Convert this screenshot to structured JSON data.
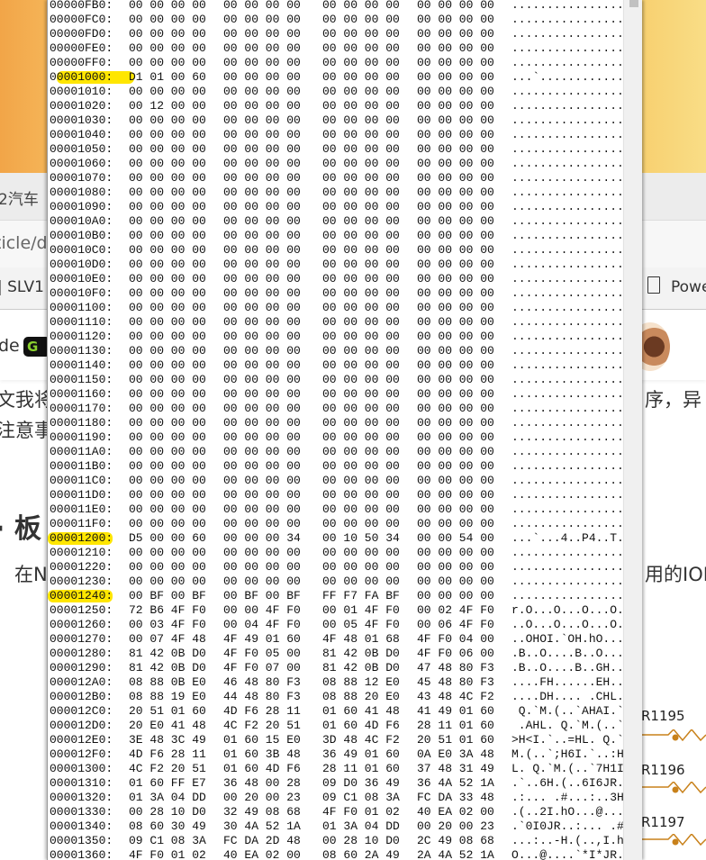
{
  "background": {
    "tab_text": "2汽车",
    "address_text": "ticle/d",
    "bookmark_left": "| SLV1",
    "bookmark_right": "Powe",
    "author_left": "de",
    "badge": "G",
    "para_line1_left": "文我将",
    "para_line2_left": "注意事",
    "para_line1_right": "序，异",
    "heading_left": "· 板",
    "para2_left": "在N",
    "para2_right": "用的IOD",
    "resistors": [
      "R1195",
      "R1196",
      "R1197"
    ],
    "accent": "#c8811a"
  },
  "hex_view": {
    "rows": [
      {
        "offset": "00000FB0:",
        "hex": [
          "00 00 00 00",
          "00 00 00 00",
          "00 00 00 00",
          "00 00 00 00"
        ],
        "ascii": "................"
      },
      {
        "offset": "00000FC0:",
        "hex": [
          "00 00 00 00",
          "00 00 00 00",
          "00 00 00 00",
          "00 00 00 00"
        ],
        "ascii": "................"
      },
      {
        "offset": "00000FD0:",
        "hex": [
          "00 00 00 00",
          "00 00 00 00",
          "00 00 00 00",
          "00 00 00 00"
        ],
        "ascii": "................"
      },
      {
        "offset": "00000FE0:",
        "hex": [
          "00 00 00 00",
          "00 00 00 00",
          "00 00 00 00",
          "00 00 00 00"
        ],
        "ascii": "................"
      },
      {
        "offset": "00000FF0:",
        "hex": [
          "00 00 00 00",
          "00 00 00 00",
          "00 00 00 00",
          "00 00 00 00"
        ],
        "ascii": "................"
      },
      {
        "offset": "00001000:",
        "hex": [
          "D1 01 00 60",
          "00 00 00 00",
          "00 00 00 00",
          "00 00 00 00"
        ],
        "ascii": "...`............",
        "highlight": true
      },
      {
        "offset": "00001010:",
        "hex": [
          "00 00 00 00",
          "00 00 00 00",
          "00 00 00 00",
          "00 00 00 00"
        ],
        "ascii": "................"
      },
      {
        "offset": "00001020:",
        "hex": [
          "00 12 00 00",
          "00 00 00 00",
          "00 00 00 00",
          "00 00 00 00"
        ],
        "ascii": "................"
      },
      {
        "offset": "00001030:",
        "hex": [
          "00 00 00 00",
          "00 00 00 00",
          "00 00 00 00",
          "00 00 00 00"
        ],
        "ascii": "................"
      },
      {
        "offset": "00001040:",
        "hex": [
          "00 00 00 00",
          "00 00 00 00",
          "00 00 00 00",
          "00 00 00 00"
        ],
        "ascii": "................"
      },
      {
        "offset": "00001050:",
        "hex": [
          "00 00 00 00",
          "00 00 00 00",
          "00 00 00 00",
          "00 00 00 00"
        ],
        "ascii": "................"
      },
      {
        "offset": "00001060:",
        "hex": [
          "00 00 00 00",
          "00 00 00 00",
          "00 00 00 00",
          "00 00 00 00"
        ],
        "ascii": "................"
      },
      {
        "offset": "00001070:",
        "hex": [
          "00 00 00 00",
          "00 00 00 00",
          "00 00 00 00",
          "00 00 00 00"
        ],
        "ascii": "................"
      },
      {
        "offset": "00001080:",
        "hex": [
          "00 00 00 00",
          "00 00 00 00",
          "00 00 00 00",
          "00 00 00 00"
        ],
        "ascii": "................"
      },
      {
        "offset": "00001090:",
        "hex": [
          "00 00 00 00",
          "00 00 00 00",
          "00 00 00 00",
          "00 00 00 00"
        ],
        "ascii": "................"
      },
      {
        "offset": "000010A0:",
        "hex": [
          "00 00 00 00",
          "00 00 00 00",
          "00 00 00 00",
          "00 00 00 00"
        ],
        "ascii": "................"
      },
      {
        "offset": "000010B0:",
        "hex": [
          "00 00 00 00",
          "00 00 00 00",
          "00 00 00 00",
          "00 00 00 00"
        ],
        "ascii": "................"
      },
      {
        "offset": "000010C0:",
        "hex": [
          "00 00 00 00",
          "00 00 00 00",
          "00 00 00 00",
          "00 00 00 00"
        ],
        "ascii": "................"
      },
      {
        "offset": "000010D0:",
        "hex": [
          "00 00 00 00",
          "00 00 00 00",
          "00 00 00 00",
          "00 00 00 00"
        ],
        "ascii": "................"
      },
      {
        "offset": "000010E0:",
        "hex": [
          "00 00 00 00",
          "00 00 00 00",
          "00 00 00 00",
          "00 00 00 00"
        ],
        "ascii": "................"
      },
      {
        "offset": "000010F0:",
        "hex": [
          "00 00 00 00",
          "00 00 00 00",
          "00 00 00 00",
          "00 00 00 00"
        ],
        "ascii": "................"
      },
      {
        "offset": "00001100:",
        "hex": [
          "00 00 00 00",
          "00 00 00 00",
          "00 00 00 00",
          "00 00 00 00"
        ],
        "ascii": "................"
      },
      {
        "offset": "00001110:",
        "hex": [
          "00 00 00 00",
          "00 00 00 00",
          "00 00 00 00",
          "00 00 00 00"
        ],
        "ascii": "................"
      },
      {
        "offset": "00001120:",
        "hex": [
          "00 00 00 00",
          "00 00 00 00",
          "00 00 00 00",
          "00 00 00 00"
        ],
        "ascii": "................"
      },
      {
        "offset": "00001130:",
        "hex": [
          "00 00 00 00",
          "00 00 00 00",
          "00 00 00 00",
          "00 00 00 00"
        ],
        "ascii": "................"
      },
      {
        "offset": "00001140:",
        "hex": [
          "00 00 00 00",
          "00 00 00 00",
          "00 00 00 00",
          "00 00 00 00"
        ],
        "ascii": "................"
      },
      {
        "offset": "00001150:",
        "hex": [
          "00 00 00 00",
          "00 00 00 00",
          "00 00 00 00",
          "00 00 00 00"
        ],
        "ascii": "................"
      },
      {
        "offset": "00001160:",
        "hex": [
          "00 00 00 00",
          "00 00 00 00",
          "00 00 00 00",
          "00 00 00 00"
        ],
        "ascii": "................"
      },
      {
        "offset": "00001170:",
        "hex": [
          "00 00 00 00",
          "00 00 00 00",
          "00 00 00 00",
          "00 00 00 00"
        ],
        "ascii": "................"
      },
      {
        "offset": "00001180:",
        "hex": [
          "00 00 00 00",
          "00 00 00 00",
          "00 00 00 00",
          "00 00 00 00"
        ],
        "ascii": "................"
      },
      {
        "offset": "00001190:",
        "hex": [
          "00 00 00 00",
          "00 00 00 00",
          "00 00 00 00",
          "00 00 00 00"
        ],
        "ascii": "................"
      },
      {
        "offset": "000011A0:",
        "hex": [
          "00 00 00 00",
          "00 00 00 00",
          "00 00 00 00",
          "00 00 00 00"
        ],
        "ascii": "................"
      },
      {
        "offset": "000011B0:",
        "hex": [
          "00 00 00 00",
          "00 00 00 00",
          "00 00 00 00",
          "00 00 00 00"
        ],
        "ascii": "................"
      },
      {
        "offset": "000011C0:",
        "hex": [
          "00 00 00 00",
          "00 00 00 00",
          "00 00 00 00",
          "00 00 00 00"
        ],
        "ascii": "................"
      },
      {
        "offset": "000011D0:",
        "hex": [
          "00 00 00 00",
          "00 00 00 00",
          "00 00 00 00",
          "00 00 00 00"
        ],
        "ascii": "................"
      },
      {
        "offset": "000011E0:",
        "hex": [
          "00 00 00 00",
          "00 00 00 00",
          "00 00 00 00",
          "00 00 00 00"
        ],
        "ascii": "................"
      },
      {
        "offset": "000011F0:",
        "hex": [
          "00 00 00 00",
          "00 00 00 00",
          "00 00 00 00",
          "00 00 00 00"
        ],
        "ascii": "................"
      },
      {
        "offset": "00001200:",
        "hex": [
          "D5 00 00 60",
          "00 00 00 34",
          "00 10 50 34",
          "00 00 54 00"
        ],
        "ascii": "...`...4..P4..T.",
        "highlight": true
      },
      {
        "offset": "00001210:",
        "hex": [
          "00 00 00 00",
          "00 00 00 00",
          "00 00 00 00",
          "00 00 00 00"
        ],
        "ascii": "................"
      },
      {
        "offset": "00001220:",
        "hex": [
          "00 00 00 00",
          "00 00 00 00",
          "00 00 00 00",
          "00 00 00 00"
        ],
        "ascii": "................"
      },
      {
        "offset": "00001230:",
        "hex": [
          "00 00 00 00",
          "00 00 00 00",
          "00 00 00 00",
          "00 00 00 00"
        ],
        "ascii": "................"
      },
      {
        "offset": "00001240:",
        "hex": [
          "00 BF 00 BF",
          "00 BF 00 BF",
          "FF F7 FA BF",
          "00 00 00 00"
        ],
        "ascii": "................",
        "highlight": true
      },
      {
        "offset": "00001250:",
        "hex": [
          "72 B6 4F F0",
          "00 00 4F F0",
          "00 01 4F F0",
          "00 02 4F F0"
        ],
        "ascii": "r.O...O...O...O."
      },
      {
        "offset": "00001260:",
        "hex": [
          "00 03 4F F0",
          "00 04 4F F0",
          "00 05 4F F0",
          "00 06 4F F0"
        ],
        "ascii": "..O...O...O...O."
      },
      {
        "offset": "00001270:",
        "hex": [
          "00 07 4F 48",
          "4F 49 01 60",
          "4F 48 01 68",
          "4F F0 04 00"
        ],
        "ascii": "..OHOI.`OH.hO..."
      },
      {
        "offset": "00001280:",
        "hex": [
          "81 42 0B D0",
          "4F F0 05 00",
          "81 42 0B D0",
          "4F F0 06 00"
        ],
        "ascii": ".B..O....B..O..."
      },
      {
        "offset": "00001290:",
        "hex": [
          "81 42 0B D0",
          "4F F0 07 00",
          "81 42 0B D0",
          "47 48 80 F3"
        ],
        "ascii": ".B..O....B..GH.."
      },
      {
        "offset": "000012A0:",
        "hex": [
          "08 88 0B E0",
          "46 48 80 F3",
          "08 88 12 E0",
          "45 48 80 F3"
        ],
        "ascii": "....FH......EH.."
      },
      {
        "offset": "000012B0:",
        "hex": [
          "08 88 19 E0",
          "44 48 80 F3",
          "08 88 20 E0",
          "43 48 4C F2"
        ],
        "ascii": "....DH.... .CHL."
      },
      {
        "offset": "000012C0:",
        "hex": [
          "20 51 01 60",
          "4D F6 28 11",
          "01 60 41 48",
          "41 49 01 60"
        ],
        "ascii": " Q.`M.(..`AHAI.`"
      },
      {
        "offset": "000012D0:",
        "hex": [
          "20 E0 41 48",
          "4C F2 20 51",
          "01 60 4D F6",
          "28 11 01 60"
        ],
        "ascii": " .AHL. Q.`M.(..`"
      },
      {
        "offset": "000012E0:",
        "hex": [
          "3E 48 3C 49",
          "01 60 15 E0",
          "3D 48 4C F2",
          "20 51 01 60"
        ],
        "ascii": ">H<I.`..=HL. Q.`"
      },
      {
        "offset": "000012F0:",
        "hex": [
          "4D F6 28 11",
          "01 60 3B 48",
          "36 49 01 60",
          "0A E0 3A 48"
        ],
        "ascii": "M.(..`;H6I.`..:H"
      },
      {
        "offset": "00001300:",
        "hex": [
          "4C F2 20 51",
          "01 60 4D F6",
          "28 11 01 60",
          "37 48 31 49"
        ],
        "ascii": "L. Q.`M.(..`7H1I"
      },
      {
        "offset": "00001310:",
        "hex": [
          "01 60 FF E7",
          "36 48 00 28",
          "09 D0 36 49",
          "36 4A 52 1A"
        ],
        "ascii": ".`..6H.(..6I6JR."
      },
      {
        "offset": "00001320:",
        "hex": [
          "01 3A 04 DD",
          "00 20 00 23",
          "09 C1 08 3A",
          "FC DA 33 48"
        ],
        "ascii": ".:... .#...:..3H"
      },
      {
        "offset": "00001330:",
        "hex": [
          "00 28 10 D0",
          "32 49 08 68",
          "4F F0 01 02",
          "40 EA 02 00"
        ],
        "ascii": ".(..2I.hO...@..."
      },
      {
        "offset": "00001340:",
        "hex": [
          "08 60 30 49",
          "30 4A 52 1A",
          "01 3A 04 DD",
          "00 20 00 23"
        ],
        "ascii": ".`0I0JR..:... .#"
      },
      {
        "offset": "00001350:",
        "hex": [
          "09 C1 08 3A",
          "FC DA 2D 48",
          "00 28 10 D0",
          "2C 49 08 68"
        ],
        "ascii": "...:..-H.(..,I.h"
      },
      {
        "offset": "00001360:",
        "hex": [
          "4F F0 01 02",
          "40 EA 02 00",
          "08 60 2A 49",
          "2A 4A 52 1A"
        ],
        "ascii": "O...@....`*I*JR."
      }
    ]
  }
}
